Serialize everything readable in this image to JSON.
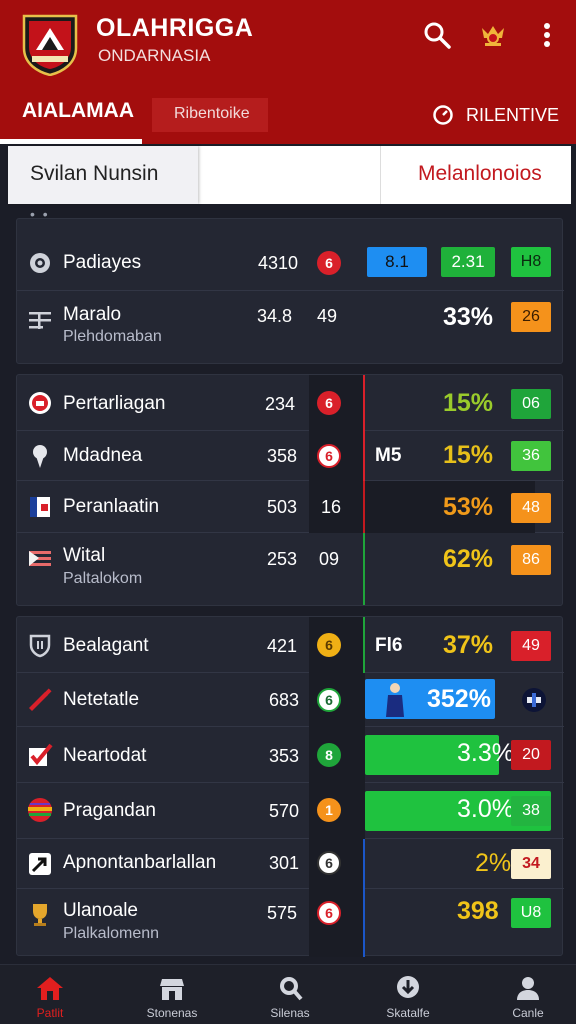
{
  "header": {
    "title": "OLAHRIGGA",
    "subtitle": "ONDARNASIA",
    "search_icon": "search-icon",
    "medal_icon": "medal-icon",
    "menu_icon": "more-vertical-icon"
  },
  "tabs": [
    {
      "label": "AIALAMAA"
    },
    {
      "label": "Ribentoike"
    },
    {
      "label": "RILENTIVE"
    }
  ],
  "subbar": {
    "left": "Svilan Nunsin",
    "right": "Melanlonoios"
  },
  "groups": [
    {
      "rows": [
        {
          "icon": "settings-icon",
          "name": "Padiayes",
          "sub": "",
          "num": "4310",
          "circle": "6",
          "v1": "8.1",
          "v2": "2.31",
          "badge": "H8"
        },
        {
          "icon": "list-icon",
          "name": "Maralo",
          "sub": "Plehdomaban",
          "num": "34.8",
          "text": "49",
          "pct": "33%",
          "badge": "26"
        }
      ]
    },
    {
      "rows": [
        {
          "icon": "ring-icon",
          "name": "Pertarliagan",
          "num": "234",
          "circle": "6",
          "pct": "15%",
          "badge": "06"
        },
        {
          "icon": "pin-icon",
          "name": "Mdadnea",
          "num": "358",
          "circle": "6",
          "label": "M5",
          "pct": "15%",
          "badge": "36"
        },
        {
          "icon": "flag-icon",
          "name": "Peranlaatin",
          "num": "503",
          "text": "16",
          "pct": "53%",
          "badge": "48"
        },
        {
          "icon": "stripes-icon",
          "name": "Wital",
          "sub": "Paltalokom",
          "num": "253",
          "text": "09",
          "pct": "62%",
          "badge": "86"
        }
      ]
    },
    {
      "rows": [
        {
          "icon": "shield-icon",
          "name": "Bealagant",
          "num": "421",
          "circle": "6",
          "label": "Fl6",
          "pct": "37%",
          "badge": "49"
        },
        {
          "icon": "bat-icon",
          "name": "Netetatle",
          "num": "683",
          "circle": "6",
          "pct": "352%",
          "badge": ""
        },
        {
          "icon": "check-icon",
          "name": "Neartodat",
          "num": "353",
          "circle": "8",
          "pct": "3.3%",
          "badge": "20"
        },
        {
          "icon": "ball-icon",
          "name": "Pragandan",
          "num": "570",
          "circle": "1",
          "pct": "3.0%",
          "badge": "38"
        },
        {
          "icon": "arrow-icon",
          "name": "Apnontanbarlallan",
          "num": "301",
          "circle": "6",
          "pct": "2%",
          "badge": "34"
        },
        {
          "icon": "trophy-icon",
          "name": "Ulanoale",
          "sub": "Plalkalomenn",
          "num": "575",
          "circle": "6",
          "pct": "398",
          "badge": "U8"
        }
      ]
    }
  ],
  "bottom_nav": [
    {
      "label": "Patlit",
      "icon": "home-icon"
    },
    {
      "label": "Stonenas",
      "icon": "store-icon"
    },
    {
      "label": "Silenas",
      "icon": "search-icon"
    },
    {
      "label": "Skatalfe",
      "icon": "download-icon"
    },
    {
      "label": "Canle",
      "icon": "user-icon"
    }
  ],
  "colors": {
    "header_red": "#a30d0d",
    "background": "#1b1d27",
    "card": "#242733",
    "yellow_pct": "#f0c419",
    "green": "#1fc23f",
    "orange": "#f5921b",
    "blue": "#1e8ef2"
  }
}
